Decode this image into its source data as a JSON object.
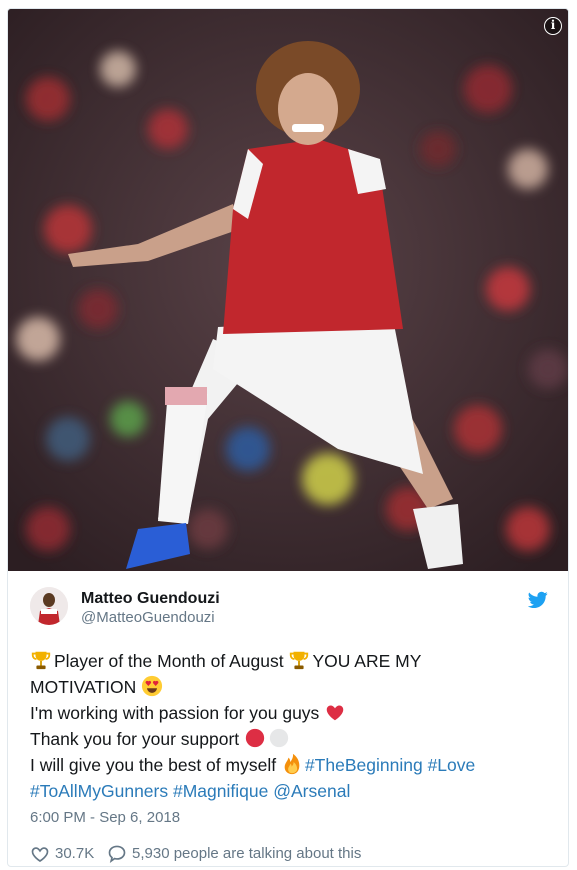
{
  "media": {
    "info_label": "i",
    "colors": {
      "shirt_red": "#c1272d",
      "shorts_white": "#f4f4f4",
      "crowd_dark": "#2c1e22"
    }
  },
  "author": {
    "name": "Matteo Guendouzi",
    "handle": "@MatteoGuendouzi",
    "brand_color": "#1da1f2"
  },
  "tweet": {
    "line1_text": "Player of the Month of August ",
    "line1_text2": "YOU ARE MY",
    "line2_text": "MOTIVATION ",
    "line3_text": "I'm working with passion for you guys ",
    "line4_text": "Thank you for your support ",
    "line5_text": "I will give you the best of myself ",
    "hashtag_beginning": "#TheBeginning",
    "hashtag_love": "#Love",
    "hashtag_gunners": "#ToAllMyGunners",
    "hashtag_magnifique": "#Magnifique",
    "mention_arsenal": "@Arsenal",
    "link_color": "#2b7bb9"
  },
  "timestamp": "6:00 PM - Sep 6, 2018",
  "actions": {
    "likes": "30.7K",
    "talking": "5,930 people are talking about this"
  },
  "icons": [
    "info-icon",
    "twitter-bird-icon",
    "trophy-icon",
    "heart-eyes-icon",
    "red-heart-icon",
    "red-circle-icon",
    "white-circle-icon",
    "fire-icon",
    "heart-icon",
    "reply-bubble-icon"
  ]
}
